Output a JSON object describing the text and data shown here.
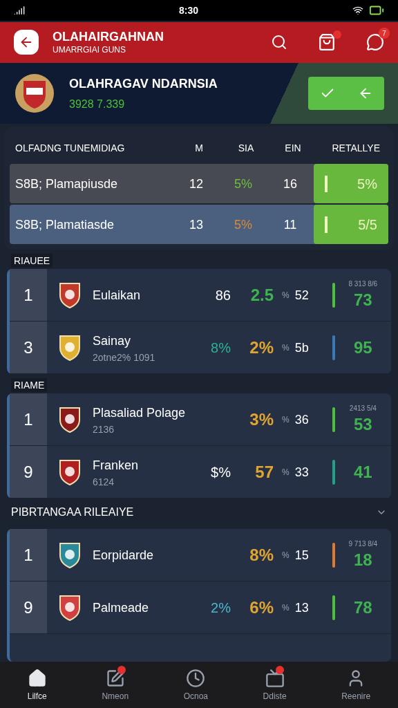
{
  "status_bar": {
    "time": "8:30"
  },
  "header": {
    "title": "OLAHAIRGAHNAN",
    "subtitle": "UMARRGIAI GUNS",
    "cart_badge": true,
    "chat_badge": "7"
  },
  "hero": {
    "name": "OLAHRAGAV NDARNSIA",
    "stat": "3928 7.339"
  },
  "summary": {
    "columns": [
      "OLFADNG TUNEMIDIAG",
      "M",
      "SIA",
      "EIN",
      "RETALLYE"
    ],
    "rows": [
      {
        "name": "S8B; Plamapiusde",
        "m": "12",
        "sia": {
          "text": "5%",
          "color": "#6fbf3f"
        },
        "ein": "16",
        "retallye": "5%",
        "selected": false
      },
      {
        "name": "S8B; Plamatiasde",
        "m": "13",
        "sia": {
          "text": "5%",
          "color": "#d98a3a"
        },
        "ein": "11",
        "retallye": "5/5",
        "selected": true
      }
    ]
  },
  "groups": [
    {
      "title": "RIAUEE",
      "kind": "plain",
      "rows": [
        {
          "rank": "1",
          "name": "Eulaikan",
          "note": "8 313 8/6",
          "extra": {
            "text": "86",
            "color": "#ffffff"
          },
          "pct": {
            "text": "2.5",
            "color": "#3fb34f"
          },
          "unit": "%",
          "count": "52",
          "bar": {
            "color": "#4cc13a"
          },
          "score": "73"
        },
        {
          "rank": "3",
          "name": "Sainay",
          "sub": "2otne2% 1091",
          "extra": {
            "text": "8%",
            "color": "#2bb39a"
          },
          "pct": {
            "text": "2%",
            "color": "#e0a530"
          },
          "unit": "%",
          "count": "5b",
          "bar": {
            "color": "#3a7ab8"
          },
          "score": "95"
        }
      ]
    },
    {
      "title": "RIAME",
      "kind": "plain",
      "rows": [
        {
          "rank": "1",
          "name": "Plasaliad Polage",
          "sub": "2136",
          "note": "2413 5/4",
          "pct": {
            "text": "3%",
            "color": "#e0a530"
          },
          "unit": "%",
          "count": "36",
          "bar": {
            "color": "#4cc13a"
          },
          "score": "53"
        },
        {
          "rank": "9",
          "name": "Franken",
          "sub": "6124",
          "extra": {
            "text": "$%",
            "color": "#ffffff"
          },
          "pct": {
            "text": "57",
            "color": "#e0a530"
          },
          "unit": "%",
          "count": "33",
          "bar": {
            "color": "#23a08a"
          },
          "score": "41"
        }
      ]
    },
    {
      "title": "PIBRTANGAA RILEAIYE",
      "kind": "collapsible",
      "rows": [
        {
          "rank": "1",
          "name": "Eorpidarde",
          "note": "9 713 8/4",
          "pct": {
            "text": "8%",
            "color": "#e0a530"
          },
          "unit": "%",
          "count": "15",
          "bar": {
            "color": "#e07a30"
          },
          "score": "18"
        },
        {
          "rank": "9",
          "name": "Palmeade",
          "extra": {
            "text": "2%",
            "color": "#4ab8c8"
          },
          "pct": {
            "text": "6%",
            "color": "#e0a530"
          },
          "unit": "%",
          "count": "13",
          "bar": {
            "color": "#4cc13a"
          },
          "score": "78"
        }
      ]
    }
  ],
  "nav": [
    {
      "label": "Lilfce",
      "selected": true,
      "badge": false
    },
    {
      "label": "Nmeon",
      "selected": false,
      "badge": true
    },
    {
      "label": "Ocnoa",
      "selected": false,
      "badge": false
    },
    {
      "label": "Ddiste",
      "selected": false,
      "badge": true
    },
    {
      "label": "Reenire",
      "selected": false,
      "badge": false
    }
  ]
}
